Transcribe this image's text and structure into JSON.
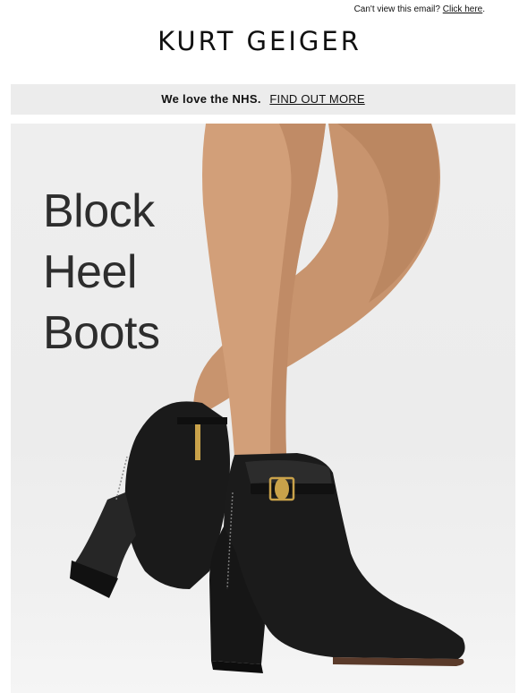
{
  "preheader": {
    "text": "Can't view this email?",
    "link": "Click here",
    "suffix": "."
  },
  "brand": {
    "logo_text": "KURT GEIGER"
  },
  "banner": {
    "message": "We love the NHS.",
    "link": "FIND OUT MORE"
  },
  "hero": {
    "title_lines": [
      "Block",
      "Heel",
      "Boots"
    ],
    "image_alt": "Black leather block heel ankle boot with gold eagle hardware"
  },
  "colors": {
    "banner_bg": "#ececec",
    "hero_bg": "#eeeeee",
    "text": "#111111",
    "boot": "#1a1a1a",
    "hardware": "#c9a24a"
  }
}
